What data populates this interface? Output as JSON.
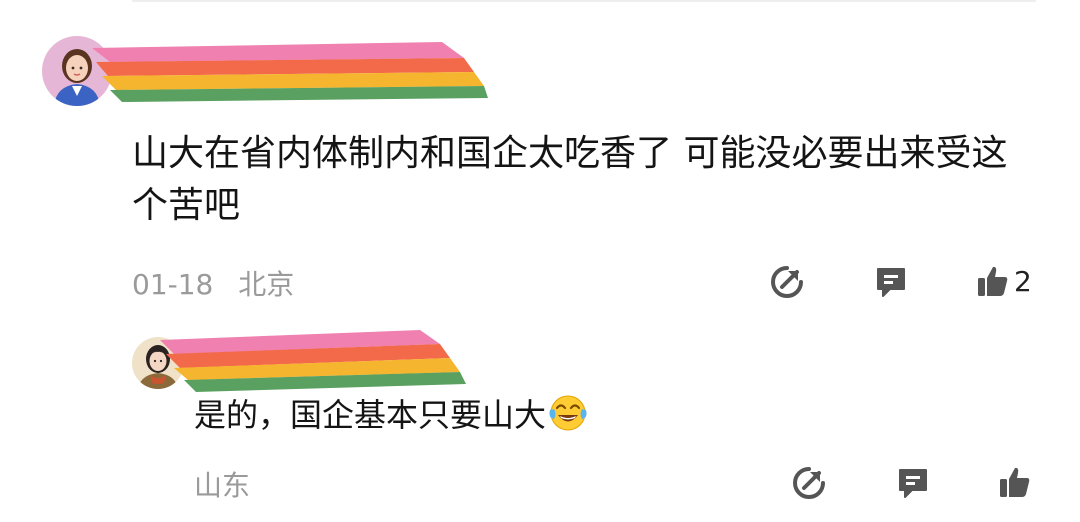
{
  "comment": {
    "text": "山大在省内体制内和国企太吃香了 可能没必要出来受这个苦吧",
    "date": "01-18",
    "location": "北京",
    "like_count": "2",
    "avatar_icon": "woman-avatar-icon"
  },
  "reply": {
    "text": "是的，国企基本只要山大",
    "emoji": "tears-of-joy-emoji",
    "location": "山东",
    "avatar_icon": "girl-avatar-icon"
  },
  "icons": {
    "share": "share-icon",
    "reply": "reply-icon",
    "like": "thumbs-up-icon"
  },
  "colors": {
    "text": "#141414",
    "meta": "#9a9a9a",
    "icon": "#555555",
    "redaction": [
      "#f080b0",
      "#f26a4a",
      "#f6b52e",
      "#5aa060"
    ]
  }
}
